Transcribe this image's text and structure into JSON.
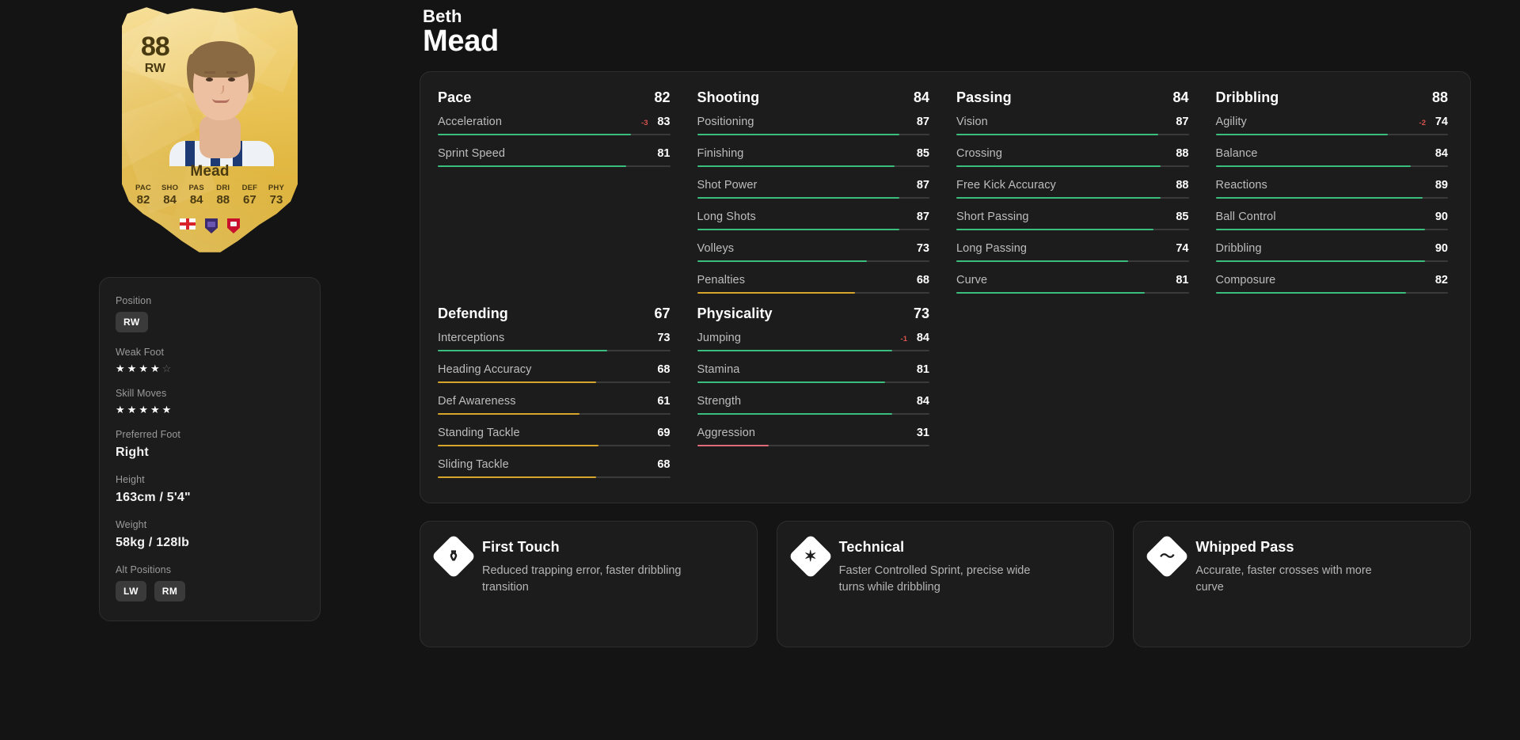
{
  "player": {
    "first_name": "Beth",
    "last_name": "Mead",
    "card": {
      "rating": "88",
      "position": "RW",
      "name": "Mead",
      "face_stats": [
        {
          "label": "PAC",
          "value": "82"
        },
        {
          "label": "SHO",
          "value": "84"
        },
        {
          "label": "PAS",
          "value": "84"
        },
        {
          "label": "DRI",
          "value": "88"
        },
        {
          "label": "DEF",
          "value": "67"
        },
        {
          "label": "PHY",
          "value": "73"
        }
      ],
      "badges": [
        "england-flag-icon",
        "league-badge-icon",
        "club-badge-icon"
      ]
    }
  },
  "info": {
    "position": {
      "label": "Position",
      "value": "RW"
    },
    "weak_foot": {
      "label": "Weak Foot",
      "filled": 4,
      "total": 5
    },
    "skill_moves": {
      "label": "Skill Moves",
      "filled": 5,
      "total": 5
    },
    "preferred_foot": {
      "label": "Preferred Foot",
      "value": "Right"
    },
    "height": {
      "label": "Height",
      "value": "163cm / 5'4\""
    },
    "weight": {
      "label": "Weight",
      "value": "58kg / 128lb"
    },
    "alt_positions": {
      "label": "Alt Positions",
      "values": [
        "LW",
        "RM"
      ]
    }
  },
  "colors": {
    "green": "#3bbd7e",
    "amber": "#d6a52a",
    "red": "#e0697a",
    "track": "#3a3a3a",
    "mod_down": "#d9534f"
  },
  "stat_groups": [
    {
      "name": "Pace",
      "total": "82",
      "stats": [
        {
          "name": "Acceleration",
          "value": "83",
          "mod": "-3"
        },
        {
          "name": "Sprint Speed",
          "value": "81",
          "mod": ""
        }
      ]
    },
    {
      "name": "Shooting",
      "total": "84",
      "stats": [
        {
          "name": "Positioning",
          "value": "87",
          "mod": ""
        },
        {
          "name": "Finishing",
          "value": "85",
          "mod": ""
        },
        {
          "name": "Shot Power",
          "value": "87",
          "mod": ""
        },
        {
          "name": "Long Shots",
          "value": "87",
          "mod": ""
        },
        {
          "name": "Volleys",
          "value": "73",
          "mod": ""
        },
        {
          "name": "Penalties",
          "value": "68",
          "mod": ""
        }
      ]
    },
    {
      "name": "Passing",
      "total": "84",
      "stats": [
        {
          "name": "Vision",
          "value": "87",
          "mod": ""
        },
        {
          "name": "Crossing",
          "value": "88",
          "mod": ""
        },
        {
          "name": "Free Kick Accuracy",
          "value": "88",
          "mod": ""
        },
        {
          "name": "Short Passing",
          "value": "85",
          "mod": ""
        },
        {
          "name": "Long Passing",
          "value": "74",
          "mod": ""
        },
        {
          "name": "Curve",
          "value": "81",
          "mod": ""
        }
      ]
    },
    {
      "name": "Dribbling",
      "total": "88",
      "stats": [
        {
          "name": "Agility",
          "value": "74",
          "mod": "-2"
        },
        {
          "name": "Balance",
          "value": "84",
          "mod": ""
        },
        {
          "name": "Reactions",
          "value": "89",
          "mod": ""
        },
        {
          "name": "Ball Control",
          "value": "90",
          "mod": ""
        },
        {
          "name": "Dribbling",
          "value": "90",
          "mod": ""
        },
        {
          "name": "Composure",
          "value": "82",
          "mod": ""
        }
      ]
    },
    {
      "name": "Defending",
      "total": "67",
      "stats": [
        {
          "name": "Interceptions",
          "value": "73",
          "mod": ""
        },
        {
          "name": "Heading Accuracy",
          "value": "68",
          "mod": ""
        },
        {
          "name": "Def Awareness",
          "value": "61",
          "mod": ""
        },
        {
          "name": "Standing Tackle",
          "value": "69",
          "mod": ""
        },
        {
          "name": "Sliding Tackle",
          "value": "68",
          "mod": ""
        }
      ]
    },
    {
      "name": "Physicality",
      "total": "73",
      "stats": [
        {
          "name": "Jumping",
          "value": "84",
          "mod": "-1"
        },
        {
          "name": "Stamina",
          "value": "81",
          "mod": ""
        },
        {
          "name": "Strength",
          "value": "84",
          "mod": ""
        },
        {
          "name": "Aggression",
          "value": "31",
          "mod": ""
        }
      ]
    }
  ],
  "playstyles": [
    {
      "title": "First Touch",
      "description": "Reduced trapping error, faster dribbling transition",
      "icon": "first-touch-icon",
      "glyph": "⚱"
    },
    {
      "title": "Technical",
      "description": "Faster Controlled Sprint, precise wide turns while dribbling",
      "icon": "technical-icon",
      "glyph": "✶"
    },
    {
      "title": "Whipped Pass",
      "description": "Accurate, faster crosses with more curve",
      "icon": "whipped-pass-icon",
      "glyph": "〜"
    }
  ]
}
